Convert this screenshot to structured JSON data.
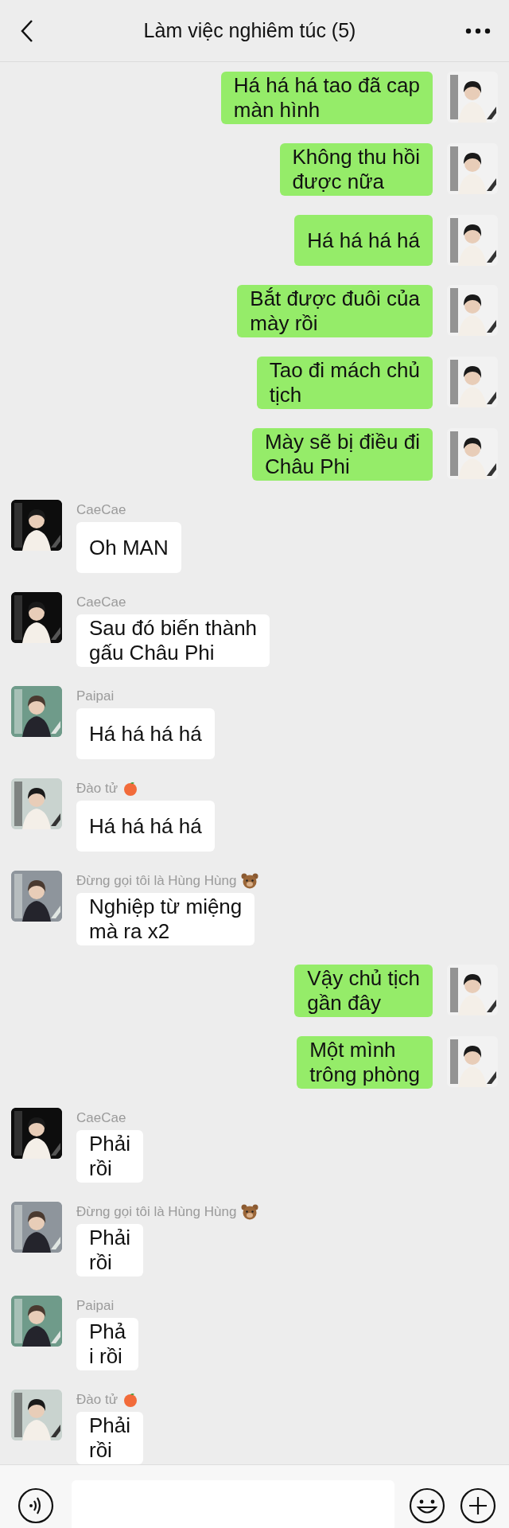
{
  "header": {
    "title": "Làm việc nghiêm túc (5)"
  },
  "messages": [
    {
      "kind": "sent",
      "text": "Há há há tao đã cap\nmàn hình"
    },
    {
      "kind": "sent",
      "text": "Không thu hồi\nđược nữa"
    },
    {
      "kind": "sent",
      "text": "Há há há há"
    },
    {
      "kind": "sent",
      "text": "Bắt được đuôi của\nmày rồi"
    },
    {
      "kind": "sent",
      "text": "Tao đi mách chủ\ntịch"
    },
    {
      "kind": "sent",
      "text": "Mày sẽ bị điều đi\nChâu Phi"
    },
    {
      "kind": "received",
      "sender": "CaeCae",
      "text": "Oh MAN"
    },
    {
      "kind": "received",
      "sender": "CaeCae",
      "text": "Sau đó biến thành\ngấu Châu Phi"
    },
    {
      "kind": "received",
      "sender": "Paipai",
      "text": "Há há há há"
    },
    {
      "kind": "received",
      "sender": "Đào tử",
      "sender_icon": {
        "kind": "peach"
      },
      "text": "Há há há há"
    },
    {
      "kind": "received",
      "sender": "Đừng gọi tôi là Hùng Hùng",
      "sender_icon": {
        "kind": "bear"
      },
      "text": "Nghiệp từ miệng\nmà ra x2"
    },
    {
      "kind": "sent",
      "text": "Vậy chủ tịch\ngần đây"
    },
    {
      "kind": "sent",
      "text": "Một mình\ntrông phòng"
    },
    {
      "kind": "received",
      "sender": "CaeCae",
      "text": "Phải\nrồi"
    },
    {
      "kind": "received",
      "sender": "Đừng gọi tôi là Hùng Hùng",
      "sender_icon": {
        "kind": "bear"
      },
      "text": "Phải\nrồi"
    },
    {
      "kind": "received",
      "sender": "Paipai",
      "text": "Phả\ni rồi"
    },
    {
      "kind": "received",
      "sender": "Đào tử",
      "sender_icon": {
        "kind": "peach"
      },
      "text": "Phải\nrồi"
    }
  ]
}
